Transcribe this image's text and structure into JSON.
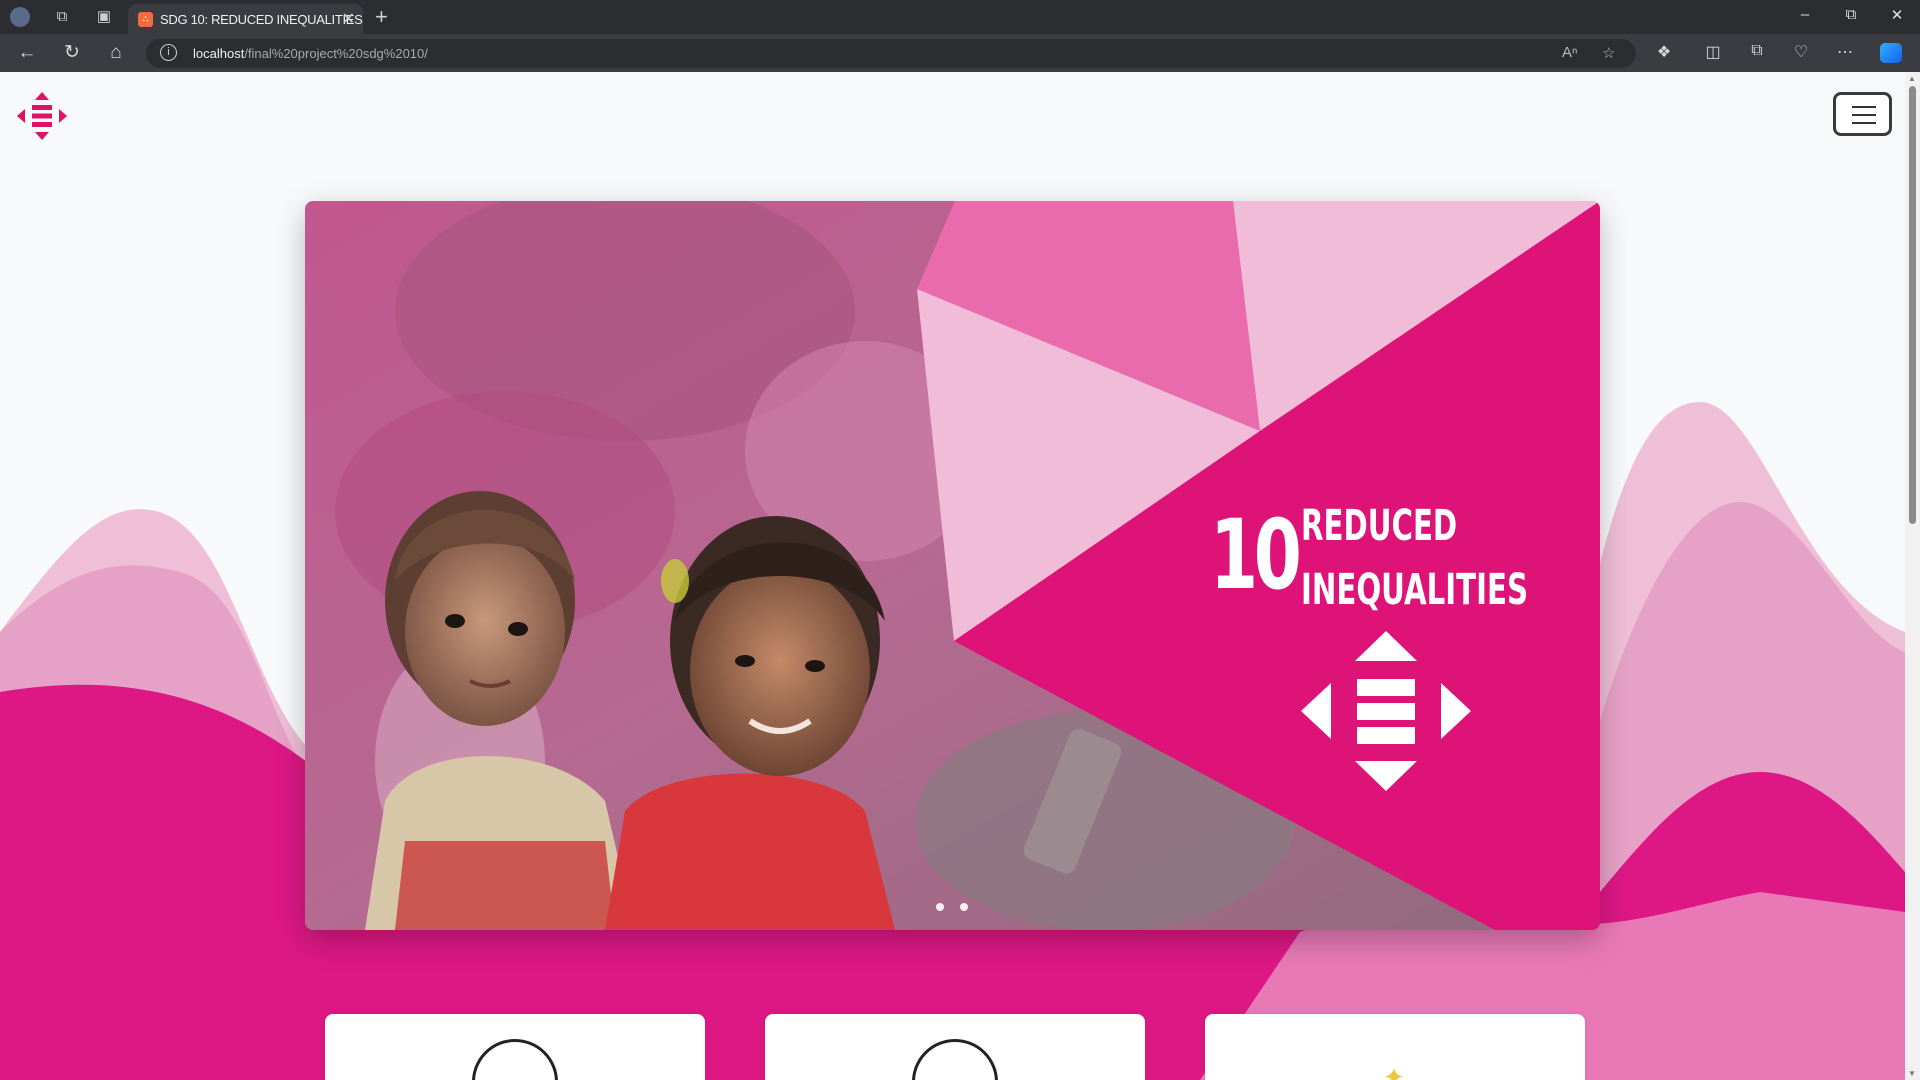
{
  "browser": {
    "tab_title": "SDG 10: REDUCED INEQUALITIES",
    "tab_favicon": "xampp-icon",
    "url_host": "localhost",
    "url_path": "/final%20project%20sdg%2010/"
  },
  "page": {
    "logo": "sdg10-logo-icon",
    "menu": "hamburger-menu-icon",
    "hero": {
      "goal_number": "10",
      "goal_line1": "REDUCED",
      "goal_line2": "INEQUALITIES",
      "emblem": "sdg10-emblem-icon",
      "slide_count": 2
    },
    "cards": [
      {
        "icon": "scales-icon"
      },
      {
        "icon": "shield-icon"
      },
      {
        "icon": "star-icon"
      }
    ]
  },
  "colors": {
    "brand": "#dd1367",
    "brand_light": "#f0bcd8",
    "brand_mid": "#e96aad"
  }
}
